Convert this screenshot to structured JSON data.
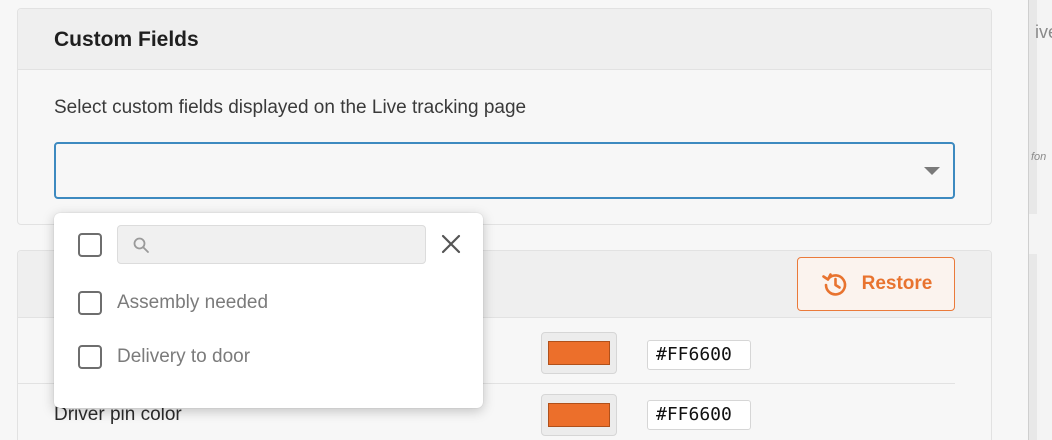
{
  "custom_fields": {
    "title": "Custom Fields",
    "description": "Select custom fields displayed on the Live tracking page",
    "select_value": ""
  },
  "dropdown": {
    "search_placeholder": "",
    "options": [
      {
        "label": "Assembly needed",
        "checked": false
      },
      {
        "label": "Delivery to door",
        "checked": false
      }
    ]
  },
  "colors_section": {
    "restore_label": "Restore",
    "rows": [
      {
        "label": "",
        "hex": "#FF6600",
        "color": "#ec6f2b"
      },
      {
        "label": "Driver pin color",
        "hex": "#FF6600",
        "color": "#ec6f2b"
      }
    ]
  },
  "map": {
    "label1": "ive",
    "label2": "fon"
  },
  "theme": {
    "accent": "#e8732f",
    "focus_border": "#3d8ac0"
  }
}
